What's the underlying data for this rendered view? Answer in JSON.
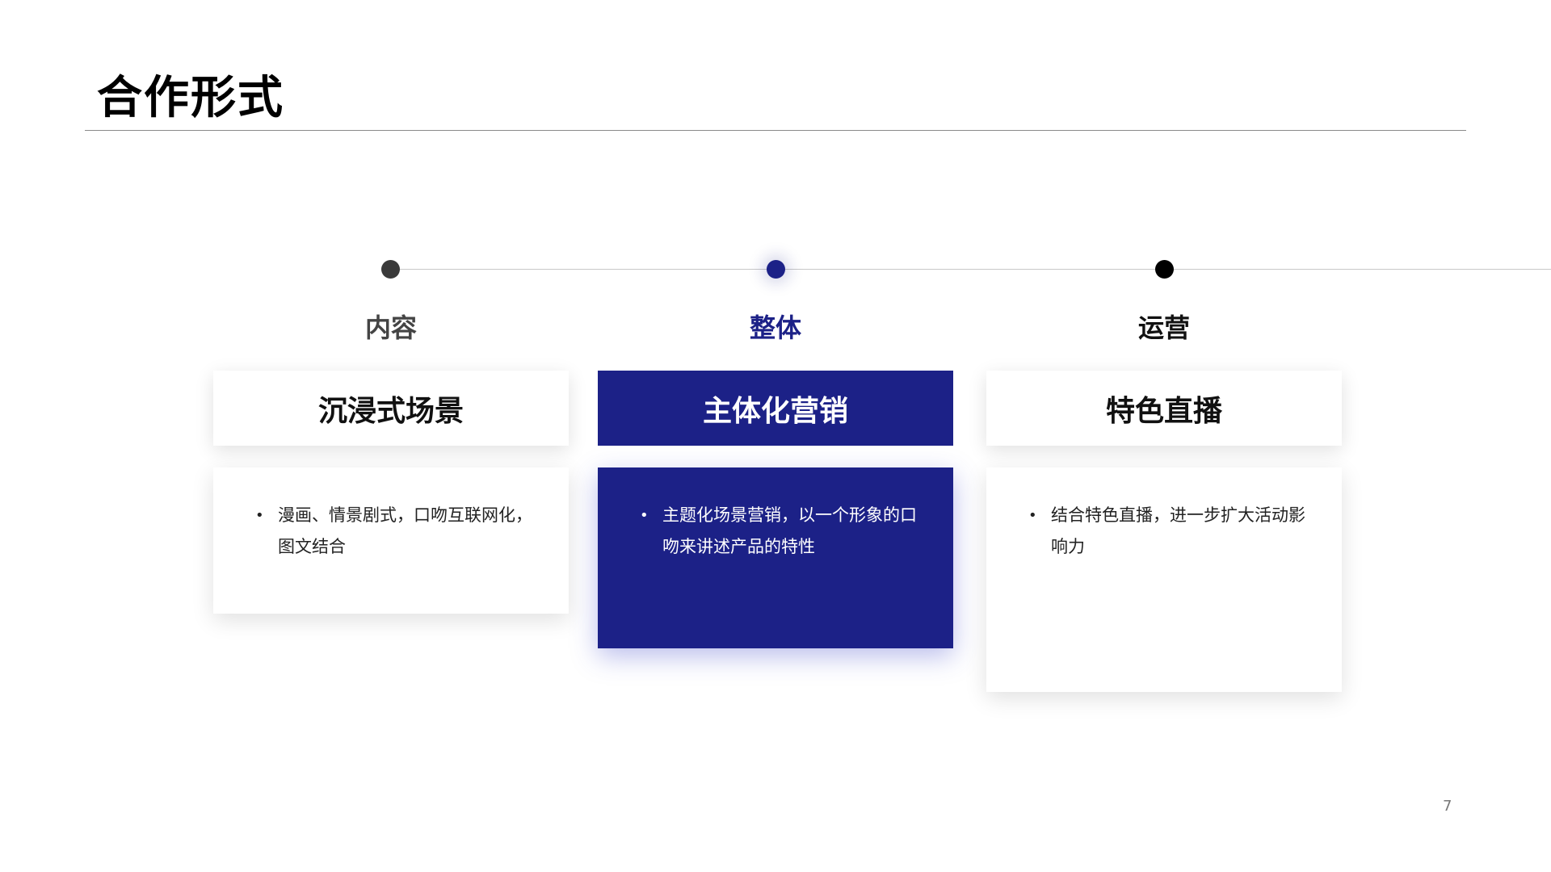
{
  "slide": {
    "title": "合作形式",
    "page_number": "7"
  },
  "columns": [
    {
      "category": "内容",
      "header": "沉浸式场景",
      "bullet": "漫画、情景剧式，口吻互联网化，图文结合"
    },
    {
      "category": "整体",
      "header": "主体化营销",
      "bullet": "主题化场景营销，以一个形象的口吻来讲述产品的特性"
    },
    {
      "category": "运营",
      "header": "特色直播",
      "bullet": "结合特色直播，进一步扩大活动影响力"
    }
  ],
  "bullet_symbol": "•",
  "colors": {
    "accent": "#1c2187",
    "text": "#111111",
    "muted": "#444444"
  }
}
